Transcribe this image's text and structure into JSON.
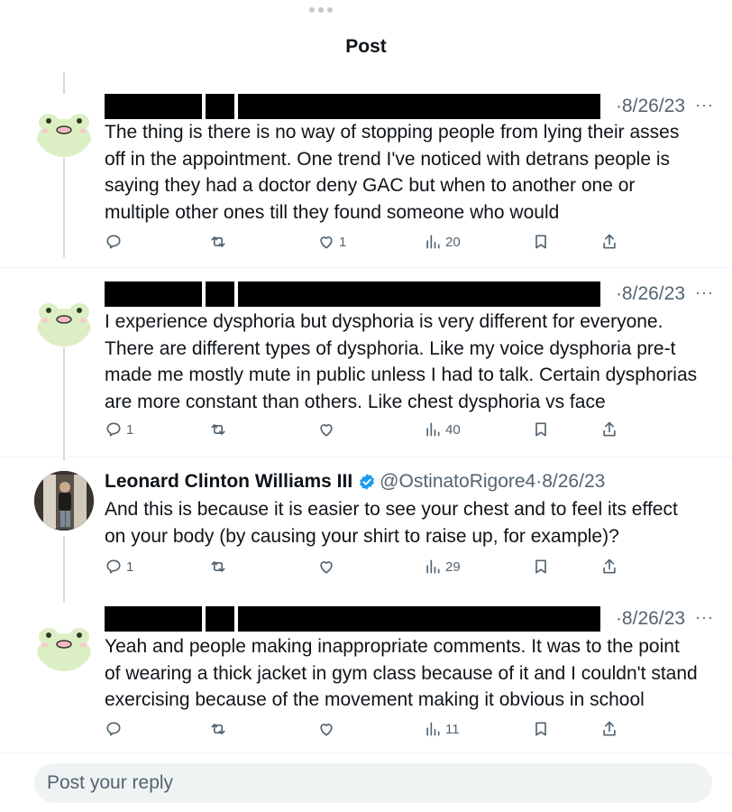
{
  "header": {
    "title": "Post"
  },
  "tweets": [
    {
      "date": "·8/26/23",
      "more": "···",
      "lines": [
        "The thing is there is no way of stopping people from lying their asses",
        "off in the appointment. One trend I've noticed with detrans people is",
        "saying they had a doctor deny GAC but when to another one or",
        "multiple other ones till they found someone who would"
      ],
      "reply_count": "",
      "repost_count": "",
      "like_count": "1",
      "views": "20"
    },
    {
      "date": "·8/26/23",
      "more": "···",
      "lines": [
        "I experience dysphoria but dysphoria is very different for everyone.",
        "There are different types of dysphoria. Like my voice dysphoria pre-t",
        "made me mostly mute in public unless I had to talk. Certain dysphorias",
        "are more constant than others. Like chest dysphoria vs face"
      ],
      "reply_count": "1",
      "repost_count": "",
      "like_count": "",
      "views": "40"
    },
    {
      "name": "Leonard Clinton Williams III",
      "handle": "@OstinatoRigore4",
      "date": "·8/26/23",
      "lines": [
        "And this is because it is easier to see your chest and to feel its effect",
        "on your body (by causing your shirt to raise up, for example)?"
      ],
      "reply_count": "1",
      "repost_count": "",
      "like_count": "",
      "views": "29"
    },
    {
      "date": "·8/26/23",
      "more": "···",
      "lines": [
        "Yeah and people making inappropriate comments. It was to the point",
        "of wearing a thick jacket in gym class because of it and I couldn't stand",
        "exercising because of the movement making it obvious in school"
      ],
      "reply_count": "",
      "repost_count": "",
      "like_count": "",
      "views": "11"
    }
  ],
  "reply": {
    "placeholder": "Post your reply"
  },
  "colors": {
    "text": "#0f1419",
    "muted": "#536471",
    "verified": "#1d9bf0",
    "frog_face": "#dcefc4",
    "frog_mouth": "#f7b7c6"
  },
  "icons": [
    "reply-icon",
    "repost-icon",
    "like-icon",
    "views-icon",
    "bookmark-icon",
    "share-icon",
    "verified-badge-icon"
  ]
}
